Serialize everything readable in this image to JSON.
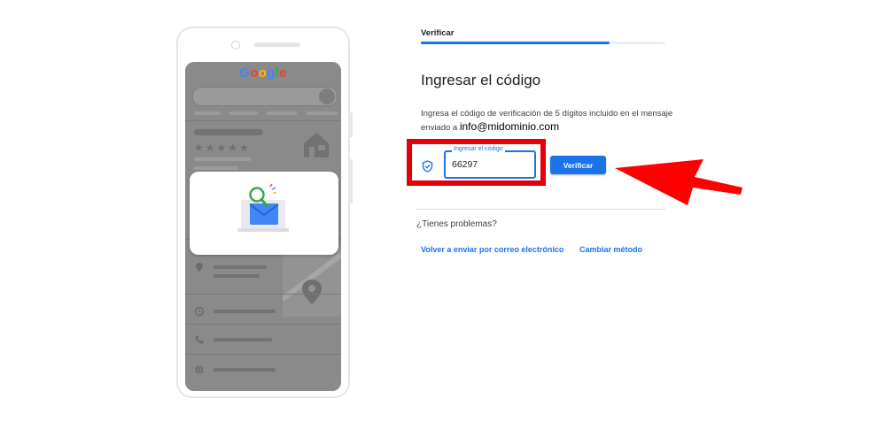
{
  "illustration": {
    "logo_letters": [
      {
        "char": "G",
        "color": "#4285f4"
      },
      {
        "char": "o",
        "color": "#ea4335"
      },
      {
        "char": "o",
        "color": "#fbbc05"
      },
      {
        "char": "g",
        "color": "#4285f4"
      },
      {
        "char": "l",
        "color": "#34a853"
      },
      {
        "char": "e",
        "color": "#ea4335"
      }
    ],
    "rating_stars": "★★★★★",
    "icons": [
      "house-icon",
      "location-pin-icon",
      "clock-icon",
      "phone-icon",
      "globe-icon",
      "map-pin-icon",
      "envelope-magnifier-icon"
    ]
  },
  "stepper": {
    "label": "Verificar",
    "progress_fraction": 0.77
  },
  "main": {
    "title": "Ingresar el código",
    "description": "Ingresa el código de verificación de 5 dígitos incluido en el mensaje enviado a",
    "email": "info@midominio.com"
  },
  "code_input": {
    "label": "Ingresar el código",
    "value": "66297"
  },
  "verify_button": {
    "label": "Verificar"
  },
  "help": {
    "question": "¿Tienes problemas?",
    "resend_link": "Volver a enviar por correo electrónico",
    "change_method_link": "Cambiar método"
  },
  "colors": {
    "accent": "#1a73e8",
    "highlight_annotation": "#e3000b"
  }
}
